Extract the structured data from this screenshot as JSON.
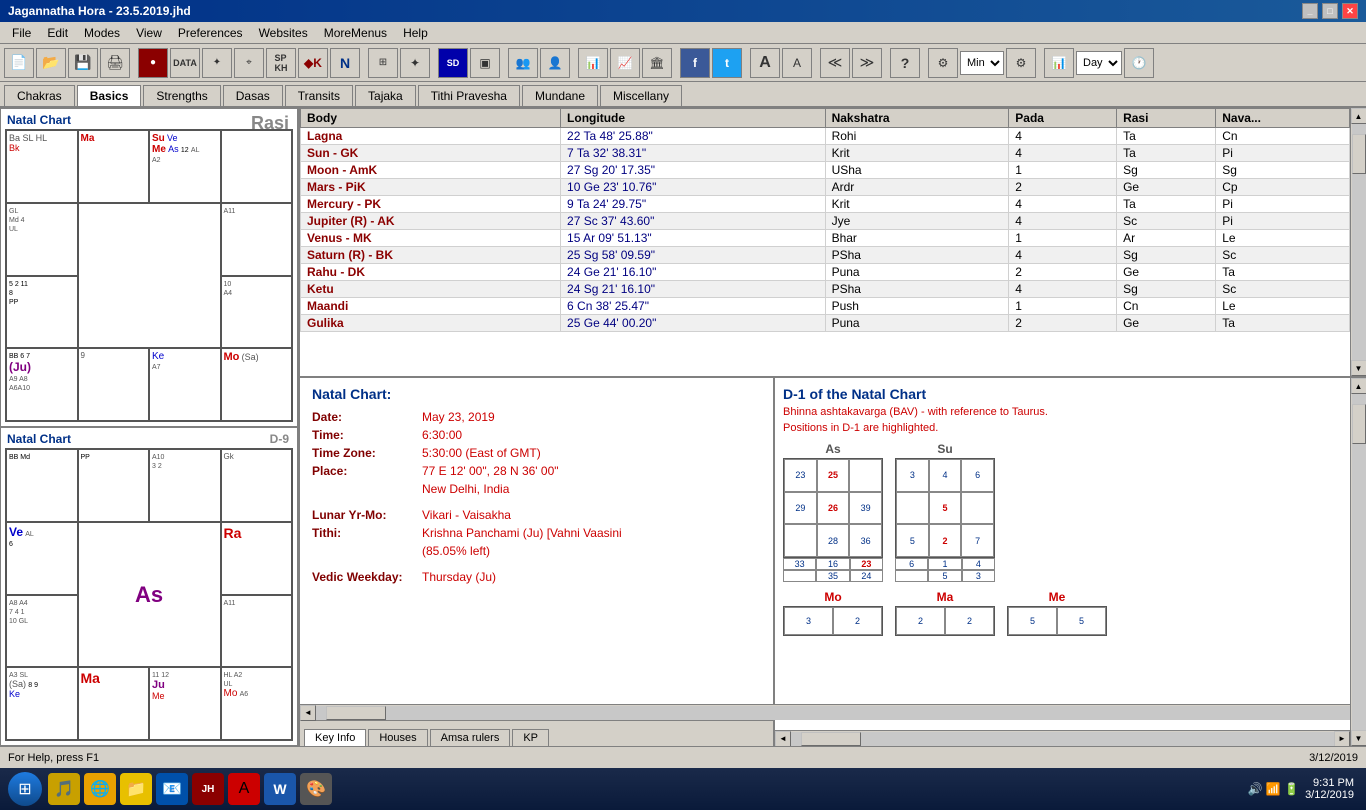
{
  "titlebar": {
    "title": "Jagannatha Hora - 23.5.2019.jhd",
    "controls": [
      "_",
      "□",
      "✕"
    ]
  },
  "menubar": {
    "items": [
      "File",
      "Edit",
      "Modes",
      "View",
      "Preferences",
      "Websites",
      "MoreMenus",
      "Help"
    ]
  },
  "toolbar": {
    "min_label": "Min",
    "day_label": "Day"
  },
  "tabs": {
    "items": [
      "Chakras",
      "Basics",
      "Strengths",
      "Dasas",
      "Transits",
      "Tajaka",
      "Tithi Pravesha",
      "Mundane",
      "Miscellany"
    ],
    "active": "Basics"
  },
  "chart1": {
    "title": "Natal Chart",
    "label": "Rasi",
    "cells": {
      "top_left": {
        "lines": [
          "Ba SL HL",
          "Bk",
          ""
        ]
      },
      "top_mid_left": {
        "lines": [
          "GL",
          "Md 4",
          "UL"
        ]
      },
      "top_mid_right": {
        "lines": [
          "Su Ve",
          "Me As",
          "12 AL",
          "A2"
        ]
      },
      "top_right": {
        "lines": [
          ""
        ]
      },
      "mid_left": {
        "lines": [
          "5 2 11",
          "8",
          "PP"
        ]
      },
      "center": {
        "lines": [
          ""
        ]
      },
      "mid_right": {
        "lines": [
          "A11",
          "10",
          "A4"
        ]
      },
      "bottom_left": {
        "lines": [
          "BB 6 7",
          "(Ju)",
          "A9 A8",
          "A6 A10"
        ]
      },
      "bottom_mid_left": {
        "lines": [
          "9"
        ]
      },
      "bottom_mid_right": {
        "lines": [
          "Ke",
          "A7"
        ]
      },
      "bottom_right": {
        "lines": [
          "Mo(Sa)",
          ""
        ]
      },
      "main_planet": "Ma",
      "sub_planets": "Su Ve Me As"
    }
  },
  "chart2": {
    "title": "Natal Chart",
    "label": "D-9",
    "cells": {}
  },
  "table": {
    "columns": [
      "Body",
      "Longitude",
      "Nakshatra",
      "Pada",
      "Rasi",
      "Nava..."
    ],
    "rows": [
      {
        "body": "Lagna",
        "longitude": "22 Ta 48' 25.88\"",
        "nakshatra": "Rohi",
        "pada": "4",
        "rasi": "Ta",
        "nava": "Cn"
      },
      {
        "body": "Sun - GK",
        "longitude": "7 Ta 32' 38.31\"",
        "nakshatra": "Krit",
        "pada": "4",
        "rasi": "Ta",
        "nava": "Pi"
      },
      {
        "body": "Moon - AmK",
        "longitude": "27 Sg 20' 17.35\"",
        "nakshatra": "USha",
        "pada": "1",
        "rasi": "Sg",
        "nava": "Sg"
      },
      {
        "body": "Mars - PiK",
        "longitude": "10 Ge 23' 10.76\"",
        "nakshatra": "Ardr",
        "pada": "2",
        "rasi": "Ge",
        "nava": "Cp"
      },
      {
        "body": "Mercury - PK",
        "longitude": "9 Ta 24' 29.75\"",
        "nakshatra": "Krit",
        "pada": "4",
        "rasi": "Ta",
        "nava": "Pi"
      },
      {
        "body": "Jupiter (R) - AK",
        "longitude": "27 Sc 37' 43.60\"",
        "nakshatra": "Jye",
        "pada": "4",
        "rasi": "Sc",
        "nava": "Pi"
      },
      {
        "body": "Venus - MK",
        "longitude": "15 Ar 09' 51.13\"",
        "nakshatra": "Bhar",
        "pada": "1",
        "rasi": "Ar",
        "nava": "Le"
      },
      {
        "body": "Saturn (R) - BK",
        "longitude": "25 Sg 58' 09.59\"",
        "nakshatra": "PSha",
        "pada": "4",
        "rasi": "Sg",
        "nava": "Sc"
      },
      {
        "body": "Rahu - DK",
        "longitude": "24 Ge 21' 16.10\"",
        "nakshatra": "Puna",
        "pada": "2",
        "rasi": "Ge",
        "nava": "Ta"
      },
      {
        "body": "Ketu",
        "longitude": "24 Sg 21' 16.10\"",
        "nakshatra": "PSha",
        "pada": "4",
        "rasi": "Sg",
        "nava": "Sc"
      },
      {
        "body": "Maandi",
        "longitude": "6 Cn 38' 25.47\"",
        "nakshatra": "Push",
        "pada": "1",
        "rasi": "Cn",
        "nava": "Le"
      },
      {
        "body": "Gulika",
        "longitude": "25 Ge 44' 00.20\"",
        "nakshatra": "Puna",
        "pada": "2",
        "rasi": "Ge",
        "nava": "Ta"
      }
    ]
  },
  "natal_info": {
    "title": "Natal Chart:",
    "fields": [
      {
        "label": "Date:",
        "value": "May 23, 2019"
      },
      {
        "label": "Time:",
        "value": "6:30:00"
      },
      {
        "label": "Time Zone:",
        "value": "5:30:00 (East of GMT)"
      },
      {
        "label": "Place:",
        "value": "77 E 12' 00\", 28 N 36' 00\""
      },
      {
        "label": "place2",
        "value": "New Delhi, India"
      },
      {
        "label": "Lunar Yr-Mo:",
        "value": "Vikari - Vaisakha"
      },
      {
        "label": "Tithi:",
        "value": "Krishna Panchami (Ju) [Vahni Vaasini"
      },
      {
        "label": "tithi2",
        "value": "(85.05% left)"
      },
      {
        "label": "Vedic Weekday:",
        "value": "Thursday (Ju)"
      }
    ],
    "tabs": [
      "Key Info",
      "Houses",
      "Amsa rulers",
      "KP"
    ],
    "active_tab": "Key Info"
  },
  "bav": {
    "title": "D-1 of the Natal Chart",
    "subtitle1": "Bhinna ashtakavarga (BAV) - with reference to Taurus.",
    "subtitle2": "Positions in D-1 are highlighted.",
    "items": [
      {
        "label": "As",
        "cells": [
          "23",
          "25",
          "",
          "29",
          "26",
          "39",
          "",
          "28",
          "36",
          "33",
          "16",
          "23",
          "",
          "35",
          "24"
        ]
      },
      {
        "label": "Su",
        "cells": [
          "3",
          "4",
          "6",
          "",
          "5",
          "",
          "5",
          "2",
          "7",
          "6",
          "1",
          "4",
          "",
          "5",
          "3"
        ]
      },
      {
        "label": "Mo",
        "cells": [
          "",
          "3",
          "",
          "",
          "",
          "2",
          "",
          "",
          "",
          "",
          "",
          "",
          "",
          "",
          ""
        ]
      },
      {
        "label": "Ma",
        "cells": [
          "",
          "2",
          "",
          "",
          "",
          "2",
          "",
          "",
          "",
          "",
          "",
          "",
          "",
          "",
          ""
        ]
      },
      {
        "label": "Me",
        "cells": [
          "",
          "5",
          "",
          "",
          "",
          "5",
          "",
          "",
          "",
          "",
          "",
          "",
          "",
          "",
          ""
        ]
      }
    ],
    "as_grid": [
      [
        "23",
        "25",
        ""
      ],
      [
        "29",
        "26",
        "39"
      ],
      [
        "",
        "28",
        "36"
      ],
      [
        "33",
        "16",
        "23"
      ],
      [
        "",
        "35",
        "24"
      ]
    ],
    "su_grid": [
      [
        "3",
        "4",
        "6"
      ],
      [
        "",
        "5",
        ""
      ],
      [
        "5",
        "2",
        "7"
      ],
      [
        "6",
        "1",
        "4"
      ],
      [
        "",
        "5",
        "3"
      ]
    ]
  },
  "statusbar": {
    "text": "For Help, press F1",
    "time": "9:31 PM",
    "date": "3/12/2019"
  },
  "taskbar": {
    "apps": [
      "⊞",
      "🎵",
      "🌐",
      "📁",
      "📧",
      "🔵",
      "📄",
      "W",
      "🎨"
    ],
    "time": "9:31 PM",
    "date": "3/12/2019"
  }
}
